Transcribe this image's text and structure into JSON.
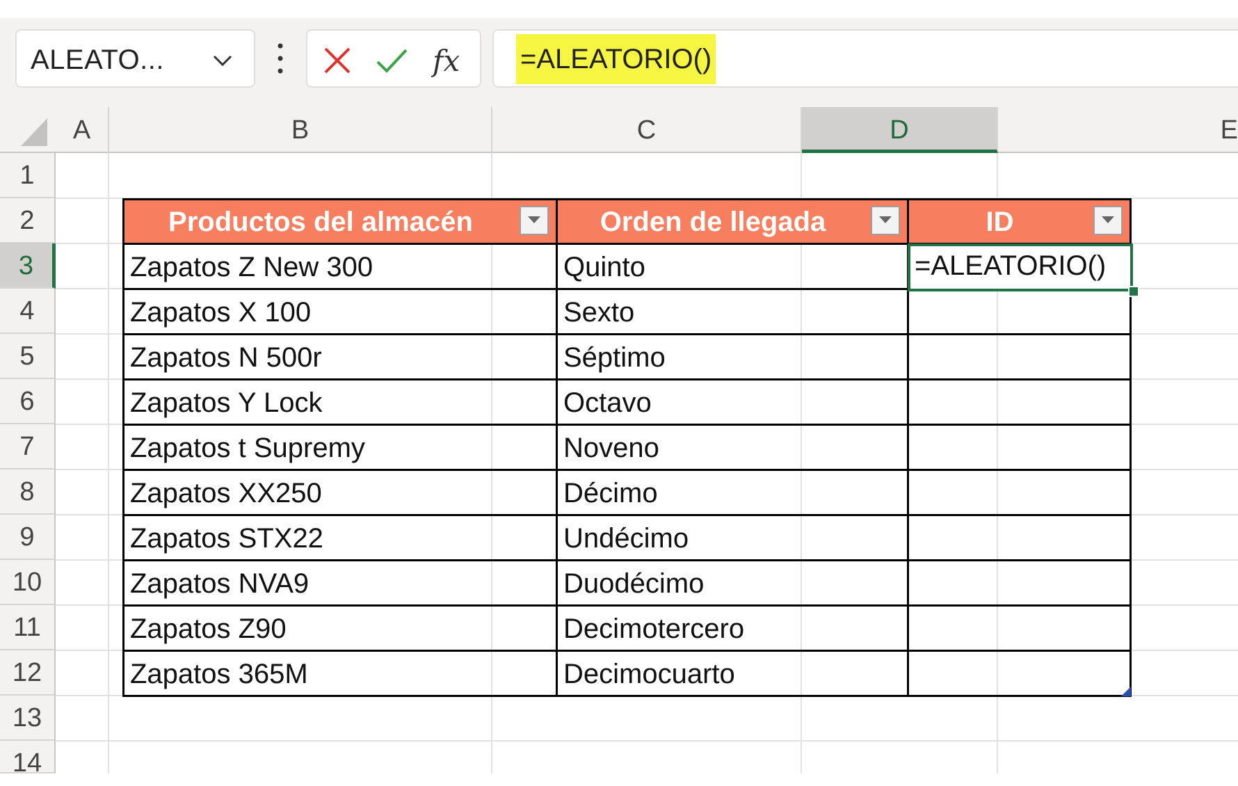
{
  "formula_bar": {
    "name_box": "ALEATO...",
    "formula": "=ALEATORIO()",
    "cancel_icon": "close-icon",
    "enter_icon": "check-icon",
    "function_icon": "fx-icon",
    "function_label": "fx"
  },
  "columns": [
    "A",
    "B",
    "C",
    "D",
    "E"
  ],
  "selected_column": "D",
  "rows": [
    "1",
    "2",
    "3",
    "4",
    "5",
    "6",
    "7",
    "8",
    "9",
    "10",
    "11",
    "12",
    "13",
    "14"
  ],
  "selected_row": "3",
  "table": {
    "headers": [
      "Productos del almacén",
      "Orden de llegada",
      "ID"
    ],
    "header_color": "#f77e5f",
    "rows": [
      {
        "producto": "Zapatos Z New 300",
        "orden": "Quinto",
        "id": "=ALEATORIO()"
      },
      {
        "producto": "Zapatos X 100",
        "orden": "Sexto",
        "id": ""
      },
      {
        "producto": "Zapatos N 500r",
        "orden": "Séptimo",
        "id": ""
      },
      {
        "producto": "Zapatos Y Lock",
        "orden": "Octavo",
        "id": ""
      },
      {
        "producto": "Zapatos t Supremy",
        "orden": "Noveno",
        "id": ""
      },
      {
        "producto": "Zapatos XX250",
        "orden": "Décimo",
        "id": ""
      },
      {
        "producto": "Zapatos STX22",
        "orden": "Undécimo",
        "id": ""
      },
      {
        "producto": "Zapatos NVA9",
        "orden": "Duodécimo",
        "id": ""
      },
      {
        "producto": "Zapatos Z90",
        "orden": "Decimotercero",
        "id": ""
      },
      {
        "producto": "Zapatos 365M",
        "orden": "Decimocuarto",
        "id": ""
      }
    ]
  },
  "colors": {
    "accent_green": "#217346",
    "formula_highlight": "#f5f542"
  }
}
